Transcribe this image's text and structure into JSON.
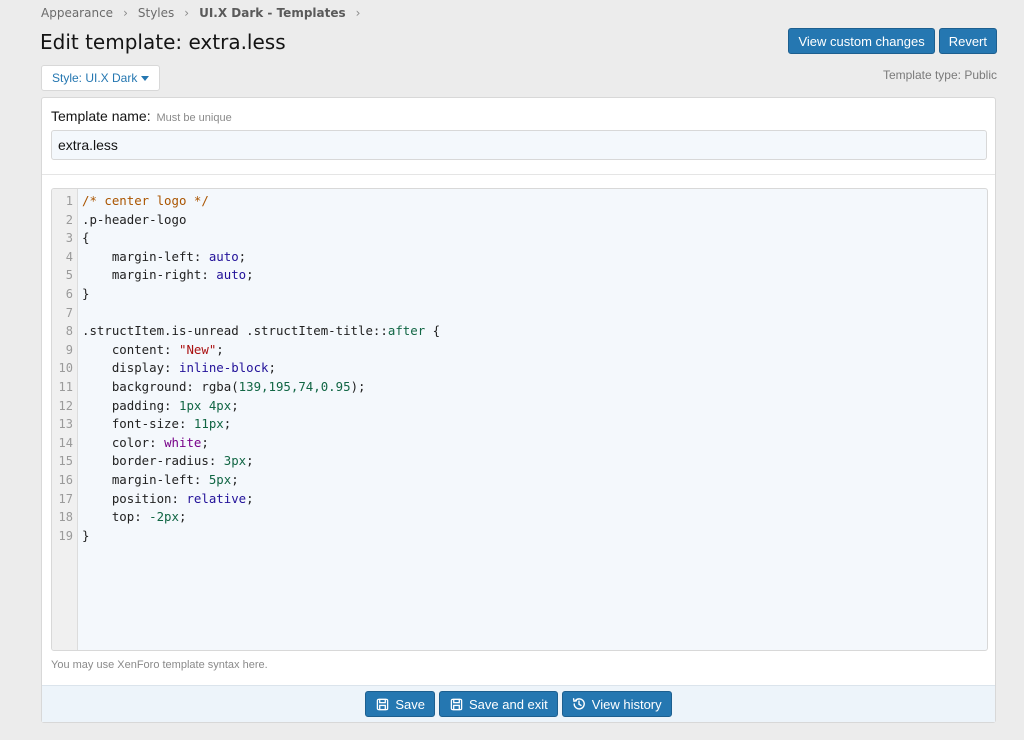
{
  "breadcrumb": {
    "items": [
      "Appearance",
      "Styles",
      "UI.X Dark - Templates"
    ]
  },
  "header": {
    "title": "Edit template: extra.less",
    "view_custom_label": "View custom changes",
    "revert_label": "Revert"
  },
  "style_selector": {
    "label": "Style: UI.X Dark"
  },
  "template_type": "Template type: Public",
  "form": {
    "name_label": "Template name:",
    "name_hint": "Must be unique",
    "name_value": "extra.less",
    "editor_hint": "You may use XenForo template syntax here."
  },
  "code_lines": [
    "1",
    "2",
    "3",
    "4",
    "5",
    "6",
    "7",
    "8",
    "9",
    "10",
    "11",
    "12",
    "13",
    "14",
    "15",
    "16",
    "17",
    "18",
    "19"
  ],
  "code": {
    "l1": "/* center logo */",
    "l2": ".p-header-logo",
    "l3": "{",
    "l4_prop": "    margin-left: ",
    "l4_val": "auto",
    "l5_prop": "    margin-right: ",
    "l5_val": "auto",
    "l6": "}",
    "l7": "",
    "l8_sel": ".structItem.is-unread .structItem-title::",
    "l8_pseudo": "after",
    "l8_brace": " {",
    "l9_prop": "    content: ",
    "l9_val": "\"New\"",
    "l10_prop": "    display: ",
    "l10_val": "inline-block",
    "l11_prop": "    background: rgba(",
    "l11_val": "139,195,74,0.95",
    "l11_end": ");",
    "l12_prop": "    padding: ",
    "l12_val": "1px 4px",
    "l13_prop": "    font-size: ",
    "l13_val": "11px",
    "l14_prop": "    color: ",
    "l14_val": "white",
    "l15_prop": "    border-radius: ",
    "l15_val": "3px",
    "l16_prop": "    margin-left: ",
    "l16_val": "5px",
    "l17_prop": "    position: ",
    "l17_val": "relative",
    "l18_prop": "    top: ",
    "l18_val": "-2px",
    "l19": "}",
    "semi": ";"
  },
  "footer": {
    "save_label": "Save",
    "save_exit_label": "Save and exit",
    "history_label": "View history"
  },
  "colors": {
    "primary": "#2577b1",
    "background": "#ececec",
    "editor_bg": "#f4f8fc"
  },
  "icons": {
    "save": "save-icon",
    "save_exit": "save-icon",
    "history": "history-icon",
    "separator": "chevron-right-icon",
    "dropdown": "caret-down-icon"
  }
}
